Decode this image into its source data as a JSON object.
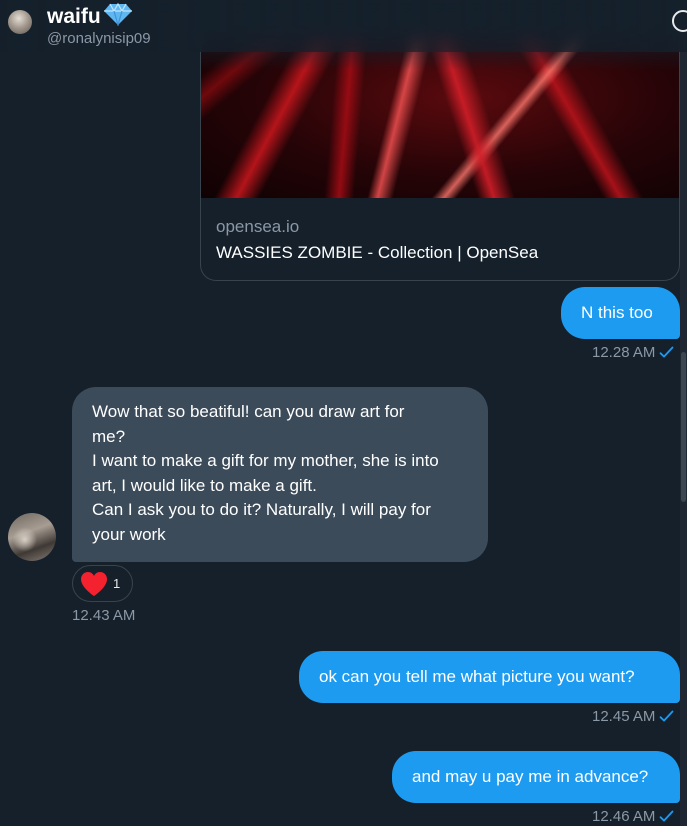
{
  "header": {
    "name": "waifu",
    "handle": "@ronalynisip09",
    "verified_icon": "gem-icon"
  },
  "link_card": {
    "domain": "opensea.io",
    "title": "WASSIES ZOMBIE - Collection | OpenSea"
  },
  "messages": [
    {
      "direction": "sent",
      "text": "N this too",
      "time": "12.28 AM",
      "status_icon": "check-icon"
    },
    {
      "direction": "received",
      "lines": [
        "Wow that so beatiful! can you draw art for",
        "me?",
        "I want to make a gift for my mother, she is into",
        "art, I would like to make a gift.",
        "Can I ask you to do it? Naturally, I will pay for",
        "your work"
      ],
      "reaction": {
        "icon": "heart-icon",
        "count": "1"
      },
      "time": "12.43 AM"
    },
    {
      "direction": "sent",
      "text": "ok can you tell me what picture you want?",
      "time": "12.45 AM",
      "status_icon": "check-icon"
    },
    {
      "direction": "sent",
      "text": "and may u pay me in advance?",
      "time": "12.46 AM",
      "status_icon": "check-icon"
    }
  ],
  "colors": {
    "background": "#15202b",
    "sent_bubble": "#1d9bf0",
    "received_bubble": "#3c4b5a",
    "muted_text": "#8b98a5",
    "heart": "#f91880"
  }
}
